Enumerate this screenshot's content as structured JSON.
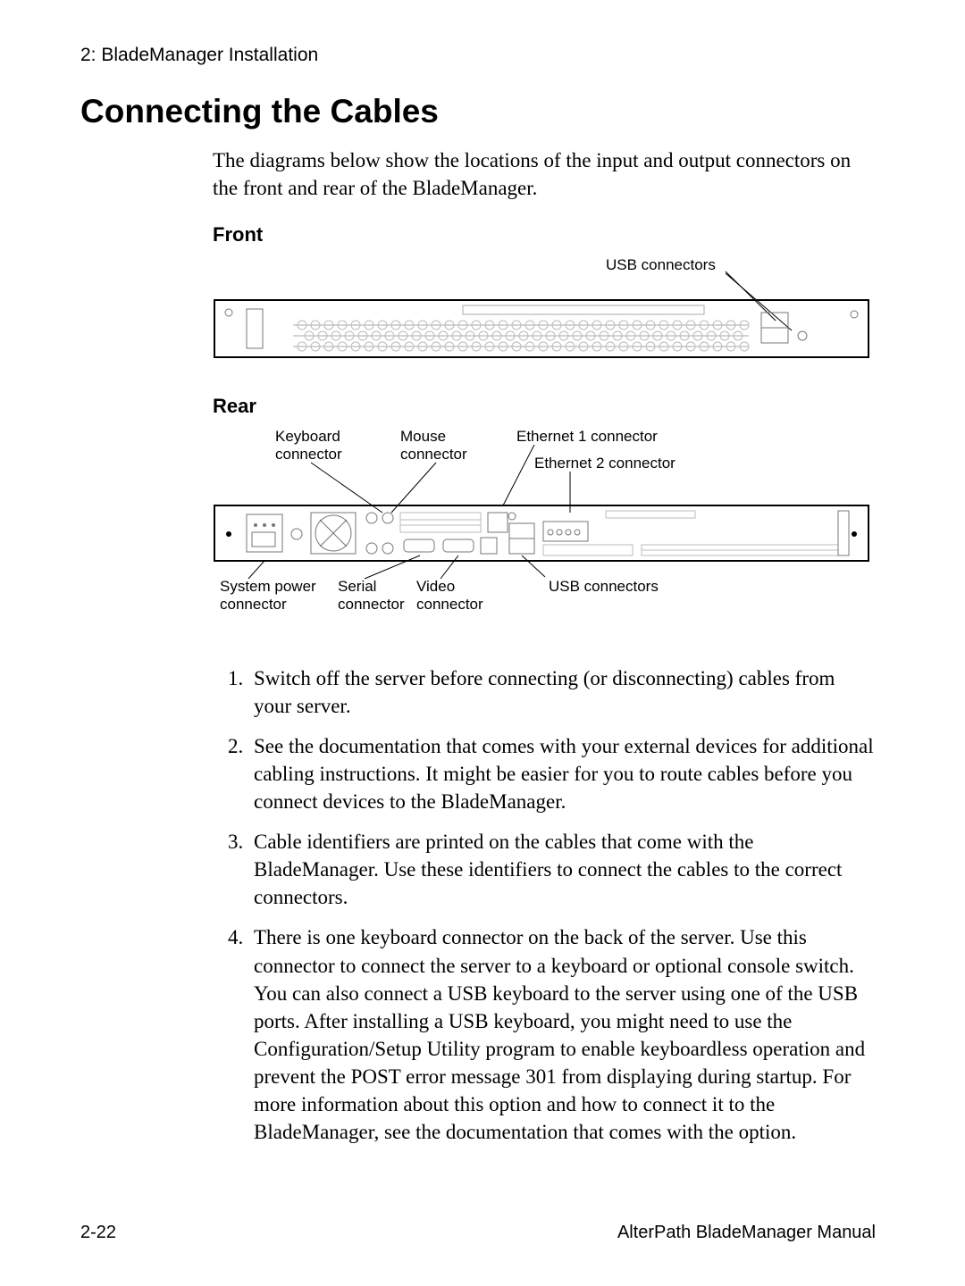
{
  "chapter": "2: BladeManager Installation",
  "title": "Connecting the Cables",
  "intro": "The diagrams below show the locations of the input and output connectors on the front and rear of the BladeManager.",
  "front_label": "Front",
  "rear_label": "Rear",
  "front": {
    "usb_connectors": "USB connectors"
  },
  "rear": {
    "keyboard": "Keyboard",
    "keyboard2": "connector",
    "mouse": "Mouse",
    "mouse2": "connector",
    "eth1": "Ethernet 1 connector",
    "eth2": "Ethernet 2 connector",
    "system_power1": "System power",
    "system_power2": "connector",
    "serial1": "Serial",
    "serial2": "connector",
    "video1": "Video",
    "video2": "connector",
    "usb": "USB connectors"
  },
  "steps": [
    "Switch off the server before connecting (or disconnecting) cables from your server.",
    "See the documentation that comes with your external devices for additional cabling instructions. It might be easier for you to route cables before you connect devices to the BladeManager.",
    "Cable identifiers are printed on the cables that come with the BladeManager. Use these identifiers to connect the cables to the correct connectors.",
    "There is one keyboard connector on the back of the server. Use this connector to connect the server to a keyboard or optional console switch. You can also connect a USB keyboard to the server using one of the USB ports. After installing a USB keyboard, you might need to use the Configuration/Setup Utility program to enable keyboardless operation and prevent the POST error message 301 from displaying during startup. For more information about this option and how to connect it to the BladeManager, see the documentation that comes with the option."
  ],
  "footer_left": "2-22",
  "footer_right": "AlterPath BladeManager Manual"
}
